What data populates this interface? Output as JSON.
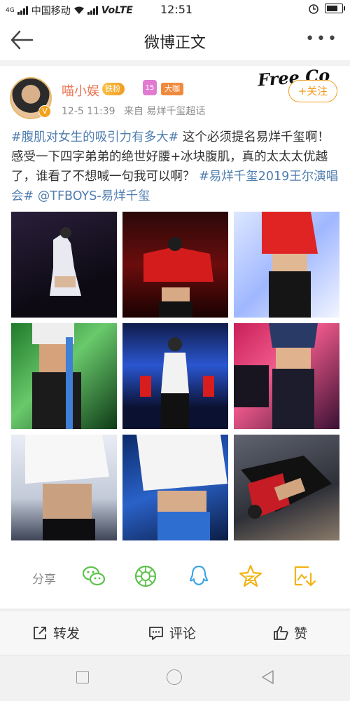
{
  "status_bar": {
    "carrier": "中国移动",
    "network": "4G",
    "volte": "VoLTE",
    "time": "12:51"
  },
  "nav": {
    "title": "微博正文",
    "back_icon": "back-arrow-icon",
    "more_icon": "more-dots-icon",
    "more_label": "•••"
  },
  "post": {
    "username": "喵小娱",
    "verified_mark": "V",
    "badges": {
      "fan": "铁粉",
      "level": "15",
      "bigshot": "大咖"
    },
    "time": "12-5 11:39",
    "source": "来自 易烊千玺超话",
    "follow_label": "+关注",
    "decor_logo": "Free Co",
    "content": {
      "topic1": "#腹肌对女生的吸引力有多大#",
      "text1": "这个必须提名易烊千玺啊！感受一下四字弟弟的绝世好腰+冰块腹肌，真的太太太优越了，谁看了不想喊一句我可以啊？",
      "topic2": "#易烊千玺2019王尔演唱会#",
      "mention": " @TFBOYS-易烊千玺"
    },
    "images_count": 9
  },
  "share": {
    "label": "分享",
    "icons": [
      "wechat-icon",
      "moments-icon",
      "qq-icon",
      "qzone-icon",
      "save-image-icon"
    ]
  },
  "actions": {
    "repost": "转发",
    "comment": "评论",
    "like": "赞"
  },
  "colors": {
    "accent_orange": "#f29c1f",
    "topic_blue": "#507daf",
    "username_orange": "#eb7350"
  }
}
